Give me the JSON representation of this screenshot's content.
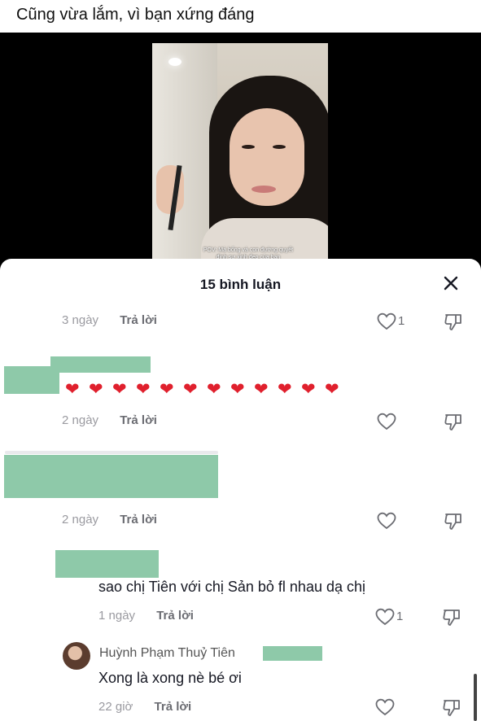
{
  "post": {
    "caption": "Cũng vừa lắm, vì bạn xứng đáng"
  },
  "video": {
    "overlay_text": "POV: Mà bống và con đường quyết định sự xinh đẹp của bạn"
  },
  "sheet": {
    "title": "15 bình luận"
  },
  "comments": [
    {
      "time": "3 ngày",
      "reply": "Trả lời",
      "likes": "1"
    },
    {
      "text": "❤️❤️❤️❤️❤️❤️❤️❤️❤️❤️❤️❤️",
      "hearts": 12,
      "time": "2 ngày",
      "reply": "Trả lời",
      "likes": ""
    },
    {
      "time": "2 ngày",
      "reply": "Trả lời",
      "likes": ""
    },
    {
      "text": "sao chị Tiên với chị Sản bỏ fl nhau dạ chị",
      "time": "1 ngày",
      "reply": "Trả lời",
      "likes": "1"
    },
    {
      "username": "Huỳnh Phạm Thuỷ Tiên",
      "text": "Xong là xong nè bé ơi",
      "time": "22 giờ",
      "reply": "Trả lời",
      "likes": ""
    }
  ],
  "colors": {
    "heart": "#e0202d",
    "redaction": "#8ec9a9"
  }
}
